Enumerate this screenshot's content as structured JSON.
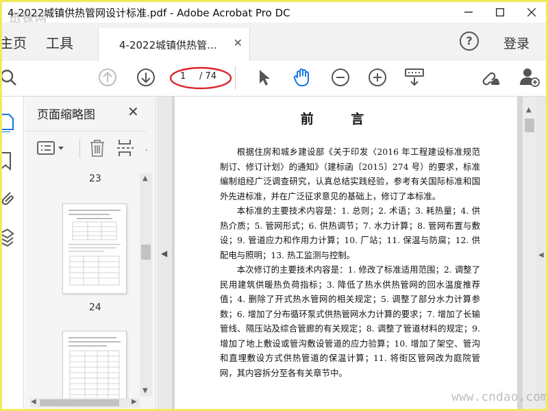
{
  "window": {
    "title": "4-2022城镇供热管网设计标准.pdf - Adobe Acrobat Pro DC",
    "watermark": "迅铢网"
  },
  "tabs": {
    "home": "主页",
    "tools": "工具",
    "document": "4-2022城镇供热管...",
    "help": "?",
    "login": "登录"
  },
  "toolbar": {
    "current_page": "1",
    "total_pages": "/ 74"
  },
  "panel": {
    "title": "页面缩略图",
    "page_labels": [
      "23",
      "24"
    ]
  },
  "document": {
    "heading": "前 言",
    "paragraphs": [
      "根据住房和城乡建设部《关于印发〈2016 年工程建设标准规范制订、修订计划〉的通知》（建标函〔2015〕274 号）的要求，标准编制组经广泛调查研究，认真总结实践经验，参考有关国际标准和国外先进标准，并在广泛征求意见的基础上，修订了本标准。",
      "本标准的主要技术内容是：1. 总则；2. 术语；3. 耗热量；4. 供热介质；5. 管网形式；6. 供热调节；7. 水力计算；8. 管网布置与敷设；9. 管道应力和作用力计算；10. 厂站；11. 保温与防腐；12. 供配电与照明；13. 热工监测与控制。",
      "本次修订的主要技术内容是：1. 修改了标准适用范围；2. 调整了民用建筑供暖热负荷指标；3. 降低了热水供热管网的回水温度推荐值；4. 删除了开式热水管网的相关规定；5. 调整了部分水力计算参数；6. 增加了分布循环泵式供热管网水力计算的要求；7. 增加了长输管线、隔压站及综合管廊的有关规定；8. 调整了管道材料的规定；9. 增加了地上敷设或管沟敷设管道的应力验算；10. 增加了架空、管沟和直埋敷设方式供热管道的保温计算；11. 将街区管网改为庭院管网，其内容拆分至各有关章节中。"
    ]
  },
  "footer_watermark": "www.cndao.com",
  "colors": {
    "border": "#f0ea5a",
    "highlight_ellipse": "#d9242a",
    "icon": "#555555",
    "hand_icon": "#1473e6"
  }
}
